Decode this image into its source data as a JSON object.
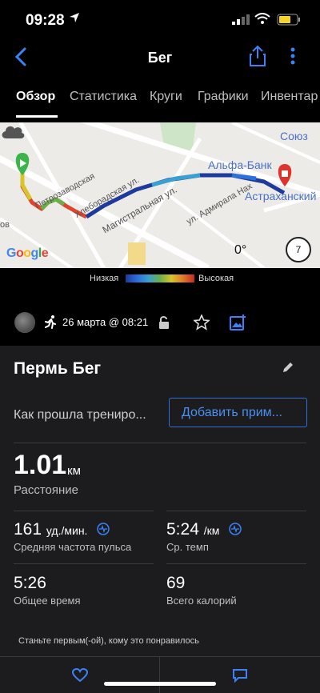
{
  "status_bar": {
    "time": "09:28"
  },
  "nav": {
    "title": "Бег"
  },
  "tabs": [
    "Обзор",
    "Статистика",
    "Круги",
    "Графики",
    "Инвентар"
  ],
  "map": {
    "street_labels": [
      "Петрозаводская",
      "Хлеборадская ул.",
      "Магистральная ул.",
      "ул. Адмирала Нах",
      "ов"
    ],
    "poi_labels": [
      "Союз",
      "Альфа-Банк",
      "Астраханский"
    ],
    "weather_temp": "0°",
    "compass_value": "7",
    "provider": "Google"
  },
  "legend": {
    "low": "Низкая",
    "high": "Высокая"
  },
  "meta": {
    "date": "26 марта @ 08:21"
  },
  "activity": {
    "title": "Пермь Бег",
    "feel_prompt": "Как прошла трениро...",
    "add_note": "Добавить прим...",
    "distance": {
      "value": "1.01",
      "unit": "км",
      "label": "Расстояние"
    },
    "heart_rate": {
      "value": "161",
      "unit": "уд./мин.",
      "label": "Средняя частота пульса"
    },
    "pace": {
      "value": "5:24",
      "unit": "/км",
      "label": "Ср. темп"
    },
    "total_time": {
      "value": "5:26",
      "label": "Общее время"
    },
    "calories": {
      "value": "69",
      "label": "Всего калорий"
    },
    "first_like": "Станьте первым(-ой), кому это понравилось"
  },
  "colors": {
    "accent": "#2f6fd6",
    "route_start": "#3bb54a",
    "route_end": "#e0332b"
  }
}
